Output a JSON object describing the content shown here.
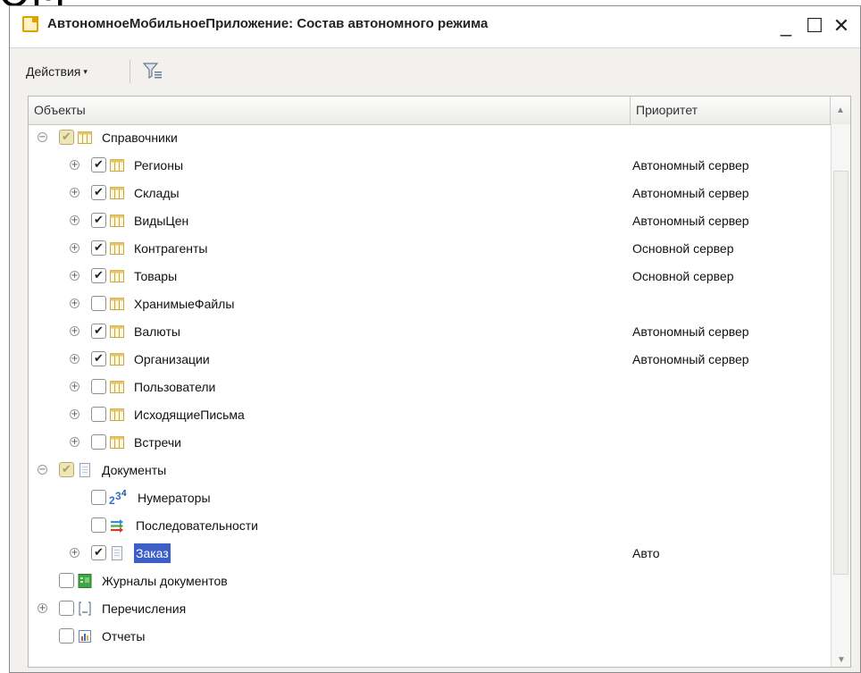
{
  "background_text": "ОМ",
  "window": {
    "title": "АвтономноеМобильноеПриложение: Состав автономного режима",
    "buttons": {
      "minimize": "_",
      "maximize": "☐",
      "close": "✕"
    }
  },
  "toolbar": {
    "actions_label": "Действия",
    "actions_caret": "▾",
    "filter_icon": "filter-icon"
  },
  "table": {
    "columns": {
      "objects": "Объекты",
      "priority": "Приоритет"
    },
    "rows": [
      {
        "label": "Справочники",
        "priority": "",
        "level": 0,
        "expander": "⊖",
        "check": "partial",
        "icon": "catalog-icon"
      },
      {
        "label": "Регионы",
        "priority": "Автономный сервер",
        "level": 1,
        "expander": "⊕",
        "check": "checked",
        "icon": "catalog-icon"
      },
      {
        "label": "Склады",
        "priority": "Автономный сервер",
        "level": 1,
        "expander": "⊕",
        "check": "checked",
        "icon": "catalog-icon"
      },
      {
        "label": "ВидыЦен",
        "priority": "Автономный сервер",
        "level": 1,
        "expander": "⊕",
        "check": "checked",
        "icon": "catalog-icon"
      },
      {
        "label": "Контрагенты",
        "priority": "Основной сервер",
        "level": 1,
        "expander": "⊕",
        "check": "checked",
        "icon": "catalog-icon"
      },
      {
        "label": "Товары",
        "priority": "Основной сервер",
        "level": 1,
        "expander": "⊕",
        "check": "checked",
        "icon": "catalog-icon"
      },
      {
        "label": "ХранимыеФайлы",
        "priority": "",
        "level": 1,
        "expander": "⊕",
        "check": "unchecked",
        "icon": "catalog-icon"
      },
      {
        "label": "Валюты",
        "priority": "Автономный сервер",
        "level": 1,
        "expander": "⊕",
        "check": "checked",
        "icon": "catalog-icon"
      },
      {
        "label": "Организации",
        "priority": "Автономный сервер",
        "level": 1,
        "expander": "⊕",
        "check": "checked",
        "icon": "catalog-icon"
      },
      {
        "label": "Пользователи",
        "priority": "",
        "level": 1,
        "expander": "⊕",
        "check": "unchecked",
        "icon": "catalog-icon"
      },
      {
        "label": "ИсходящиеПисьма",
        "priority": "",
        "level": 1,
        "expander": "⊕",
        "check": "unchecked",
        "icon": "catalog-icon"
      },
      {
        "label": "Встречи",
        "priority": "",
        "level": 1,
        "expander": "⊕",
        "check": "unchecked",
        "icon": "catalog-icon"
      },
      {
        "label": "Документы",
        "priority": "",
        "level": 0,
        "expander": "⊖",
        "check": "partial",
        "icon": "document-icon"
      },
      {
        "label": "Нумераторы",
        "priority": "",
        "level": 1,
        "expander": "",
        "check": "unchecked",
        "icon": "numerator-icon"
      },
      {
        "label": "Последовательности",
        "priority": "",
        "level": 1,
        "expander": "",
        "check": "unchecked",
        "icon": "sequence-icon"
      },
      {
        "label": "Заказ",
        "priority": "Авто",
        "level": 1,
        "expander": "⊕",
        "check": "checked",
        "icon": "document-icon",
        "selected": true
      },
      {
        "label": "Журналы документов",
        "priority": "",
        "level": 0,
        "expander": "",
        "check": "unchecked",
        "icon": "journal-icon"
      },
      {
        "label": "Перечисления",
        "priority": "",
        "level": 0,
        "expander": "⊕",
        "check": "unchecked",
        "icon": "enum-icon"
      },
      {
        "label": "Отчеты",
        "priority": "",
        "level": 0,
        "expander": "",
        "check": "unchecked",
        "icon": "report-icon"
      }
    ]
  },
  "colors": {
    "selection": "#3c5fc7",
    "catalog_icon": "#e6c56a",
    "partial_check": "#efe6b8"
  }
}
